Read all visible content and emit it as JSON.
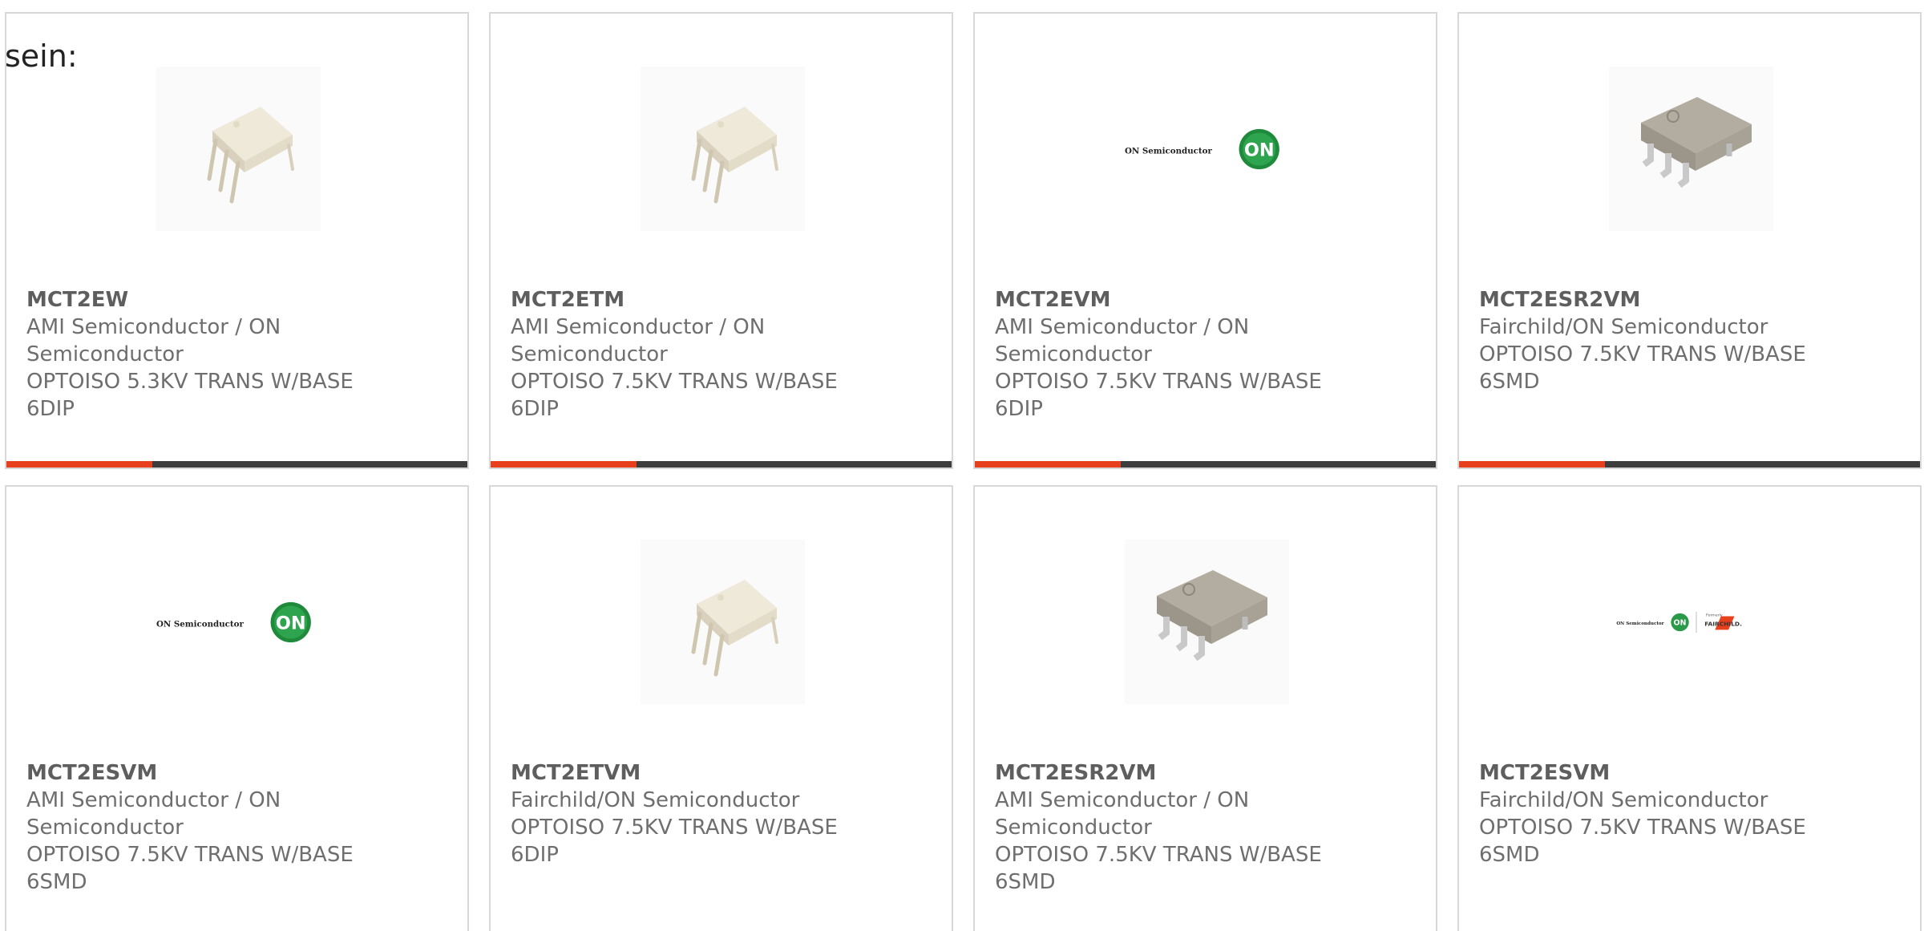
{
  "intro_text": "sein:",
  "accent_color": "#e8401c",
  "cards": [
    {
      "part": "MCT2EW",
      "manufacturer_line1": "AMI Semiconductor / ON",
      "manufacturer_line2": "Semiconductor",
      "description": "OPTOISO 5.3KV TRANS W/BASE",
      "package": "6DIP",
      "image": "6dip-package-photo"
    },
    {
      "part": "MCT2ETM",
      "manufacturer_line1": "AMI Semiconductor / ON",
      "manufacturer_line2": "Semiconductor",
      "description": "OPTOISO 7.5KV TRANS W/BASE",
      "package": "6DIP",
      "image": "6dip-package-photo"
    },
    {
      "part": "MCT2EVM",
      "manufacturer_line1": "AMI Semiconductor / ON",
      "manufacturer_line2": "Semiconductor",
      "description": "OPTOISO 7.5KV TRANS W/BASE",
      "package": "6DIP",
      "image": "on-semiconductor-logo",
      "logo_text": "ON Semiconductor",
      "logo_badge": "ON"
    },
    {
      "part": "MCT2ESR2VM",
      "manufacturer_line1": "Fairchild/ON Semiconductor",
      "manufacturer_line2": "",
      "description": "OPTOISO 7.5KV TRANS W/BASE",
      "package": "6SMD",
      "image": "6smd-package-photo"
    },
    {
      "part": "MCT2ESVM",
      "manufacturer_line1": "AMI Semiconductor / ON",
      "manufacturer_line2": "Semiconductor",
      "description": "OPTOISO 7.5KV TRANS W/BASE",
      "package": "6SMD",
      "image": "on-semiconductor-logo",
      "logo_text": "ON Semiconductor",
      "logo_badge": "ON"
    },
    {
      "part": "MCT2ETVM",
      "manufacturer_line1": "Fairchild/ON Semiconductor",
      "manufacturer_line2": "",
      "description": "OPTOISO 7.5KV TRANS W/BASE",
      "package": "6DIP",
      "image": "6dip-package-photo"
    },
    {
      "part": "MCT2ESR2VM",
      "manufacturer_line1": "AMI Semiconductor / ON",
      "manufacturer_line2": "Semiconductor",
      "description": "OPTOISO 7.5KV TRANS W/BASE",
      "package": "6SMD",
      "image": "6smd-package-photo"
    },
    {
      "part": "MCT2ESVM",
      "manufacturer_line1": "Fairchild/ON Semiconductor",
      "manufacturer_line2": "",
      "description": "OPTOISO 7.5KV TRANS W/BASE",
      "package": "6SMD",
      "image": "on-fairchild-logo",
      "logo_text": "ON Semiconductor",
      "logo_badge": "ON",
      "logo_formerly": "Formerly",
      "logo_fairchild": "FAIRCHILD."
    }
  ]
}
